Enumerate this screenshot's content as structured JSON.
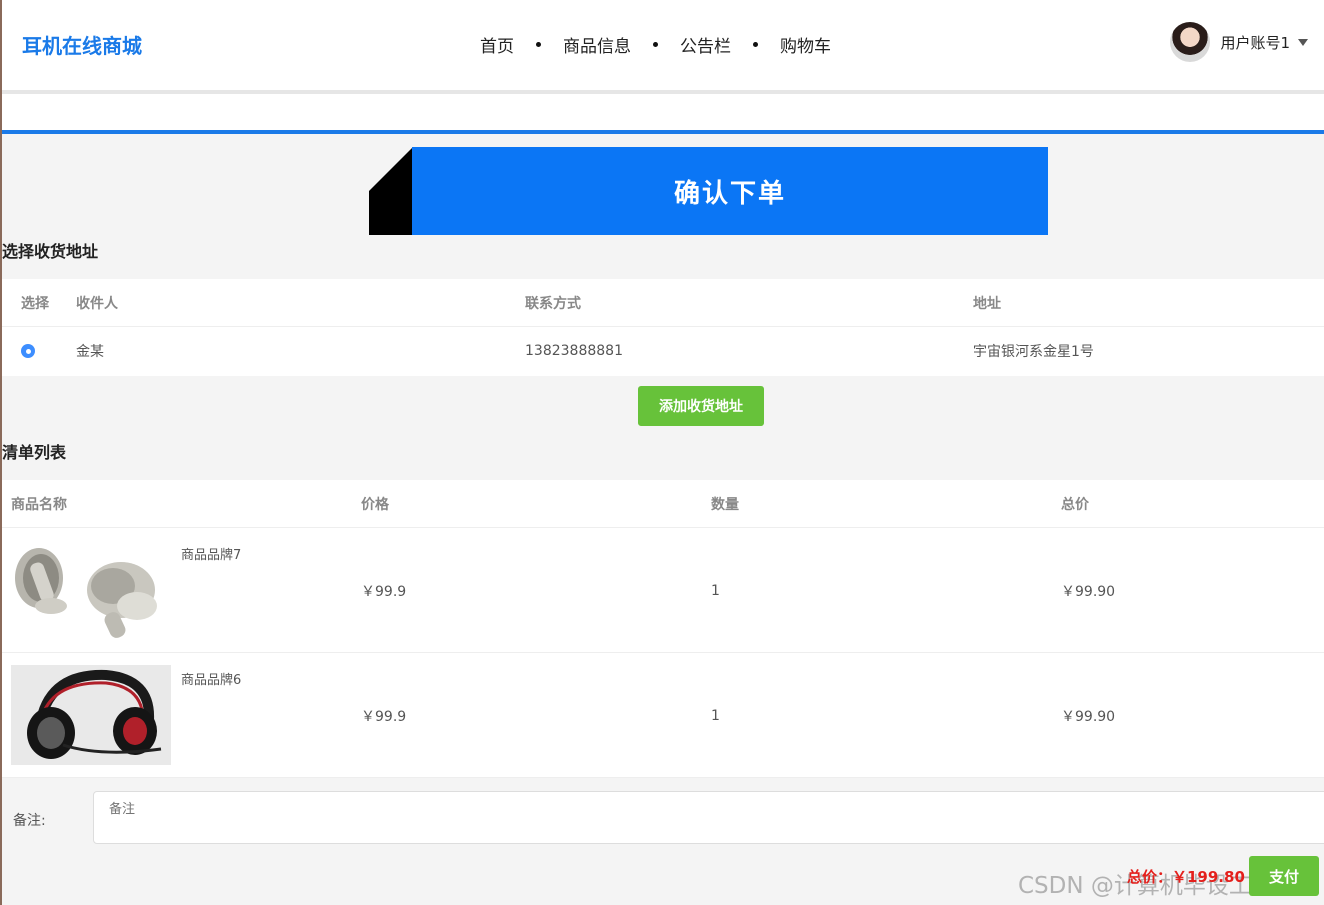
{
  "header": {
    "logo": "耳机在线商城",
    "nav": [
      "首页",
      "商品信息",
      "公告栏",
      "购物车"
    ],
    "user_name": "用户账号1"
  },
  "banner": {
    "title": "确认下单"
  },
  "address": {
    "section_title": "选择收货地址",
    "columns": [
      "选择",
      "收件人",
      "联系方式",
      "地址"
    ],
    "rows": [
      {
        "selected": true,
        "recipient": "金某",
        "phone": "13823888881",
        "address": "宇宙银河系金星1号"
      }
    ],
    "add_button": "添加收货地址"
  },
  "cart": {
    "section_title": "清单列表",
    "columns": [
      "商品名称",
      "价格",
      "数量",
      "总价"
    ],
    "rows": [
      {
        "name": "商品品牌7",
        "image": "earbuds-image",
        "price": "￥99.9",
        "qty": "1",
        "total": "￥99.90"
      },
      {
        "name": "商品品牌6",
        "image": "headset-image",
        "price": "￥99.9",
        "qty": "1",
        "total": "￥99.90"
      }
    ]
  },
  "remark": {
    "label": "备注:",
    "placeholder": "备注",
    "value": ""
  },
  "footer": {
    "total_text": "总价：￥199.80",
    "pay_button": "支付",
    "watermark": "CSDN @计算机毕设工作室"
  },
  "colors": {
    "brand": "#1a7ae8",
    "banner": "#0b76f5",
    "button_green": "#67c23a",
    "price_red": "#e4201c"
  }
}
